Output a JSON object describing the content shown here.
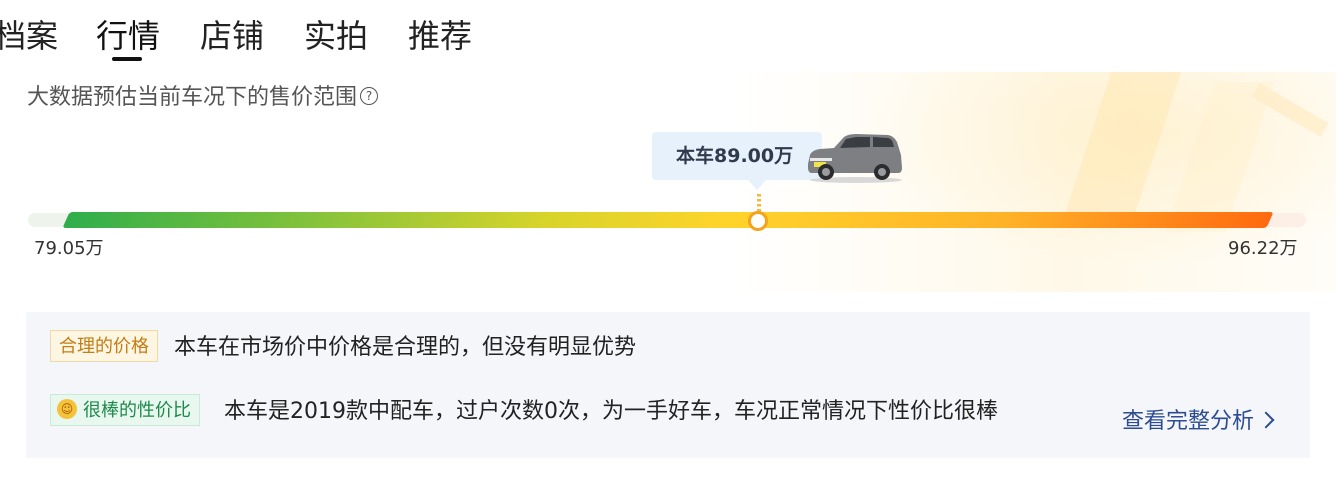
{
  "tabs": {
    "items": [
      {
        "label": "档案"
      },
      {
        "label": "行情"
      },
      {
        "label": "店铺"
      },
      {
        "label": "实拍"
      },
      {
        "label": "推荐"
      }
    ],
    "active": "行情"
  },
  "price_panel": {
    "title": "大数据预估当前车况下的售价范围",
    "help_icon": "question-circle-icon",
    "current_label": "本车89.00万",
    "current_value_wan": 89.0,
    "min_label": "79.05万",
    "max_label": "96.22万",
    "min_value_wan": 79.05,
    "max_value_wan": 96.22,
    "car_icon": "suv-car-image"
  },
  "analysis": {
    "rows": [
      {
        "badge": "合理的价格",
        "text": "本车在市场价中价格是合理的，但没有明显优势"
      },
      {
        "badge": "很棒的性价比",
        "badge_icon": "smile-icon",
        "text": "本车是2019款中配车，过户次数0次，为一手好车，车况正常情况下性价比很棒"
      }
    ],
    "link_label": "查看完整分析",
    "link_icon": "chevron-right-icon"
  },
  "colors": {
    "bar_start": "#2fae4a",
    "bar_mid": "#ffd42a",
    "bar_end": "#ff6a10",
    "marker": "#f5a21d",
    "link": "#2d4c91",
    "badge_reasonable": "#c47d14",
    "badge_great": "#1d8a4a"
  }
}
